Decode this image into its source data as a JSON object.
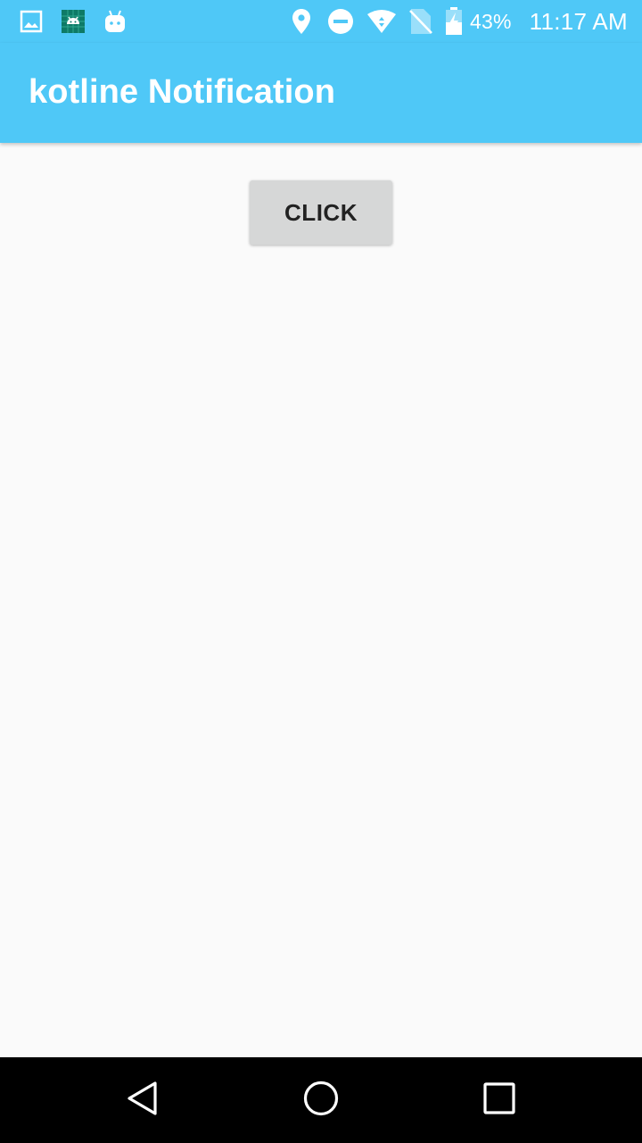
{
  "status_bar": {
    "left_icons": [
      "image-notification-icon",
      "android-debug-icon",
      "android-robot-icon"
    ],
    "right_icons": [
      "location-pin-icon",
      "do-not-disturb-icon",
      "wifi-icon",
      "no-sim-icon",
      "battery-charging-icon"
    ],
    "battery_percent": "43%",
    "time": "11:17 AM"
  },
  "app_bar": {
    "title": "kotline Notification"
  },
  "main": {
    "button_label": "CLICK"
  },
  "nav_bar": {
    "buttons": [
      "back-icon",
      "home-icon",
      "recents-icon"
    ]
  },
  "colors": {
    "primary": "#4FC8F7",
    "background": "#FAFAFA",
    "button_bg": "#D6D7D7",
    "button_text": "#222222",
    "nav_bar": "#000000"
  }
}
